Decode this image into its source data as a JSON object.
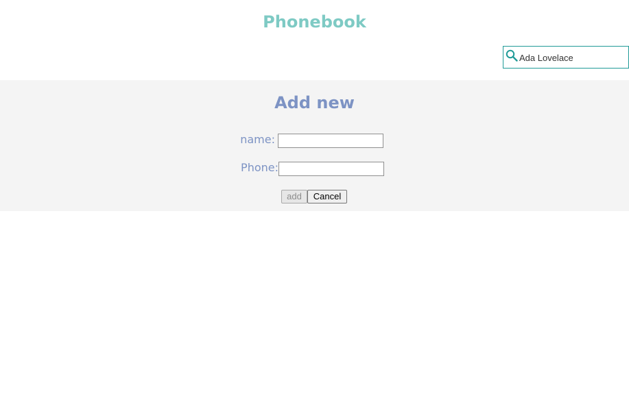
{
  "header": {
    "title": "Phonebook"
  },
  "search": {
    "value": "Ada Lovelace",
    "icon": "search-icon"
  },
  "add_form": {
    "title": "Add new",
    "name_label": "name:",
    "name_value": "",
    "phone_label": "Phone:",
    "phone_value": "",
    "add_label": "add",
    "cancel_label": "Cancel"
  },
  "colors": {
    "title": "#7ecac4",
    "accent_teal": "#1f9a97",
    "form_text": "#7d93c4",
    "panel_background": "#f4f4f4"
  }
}
